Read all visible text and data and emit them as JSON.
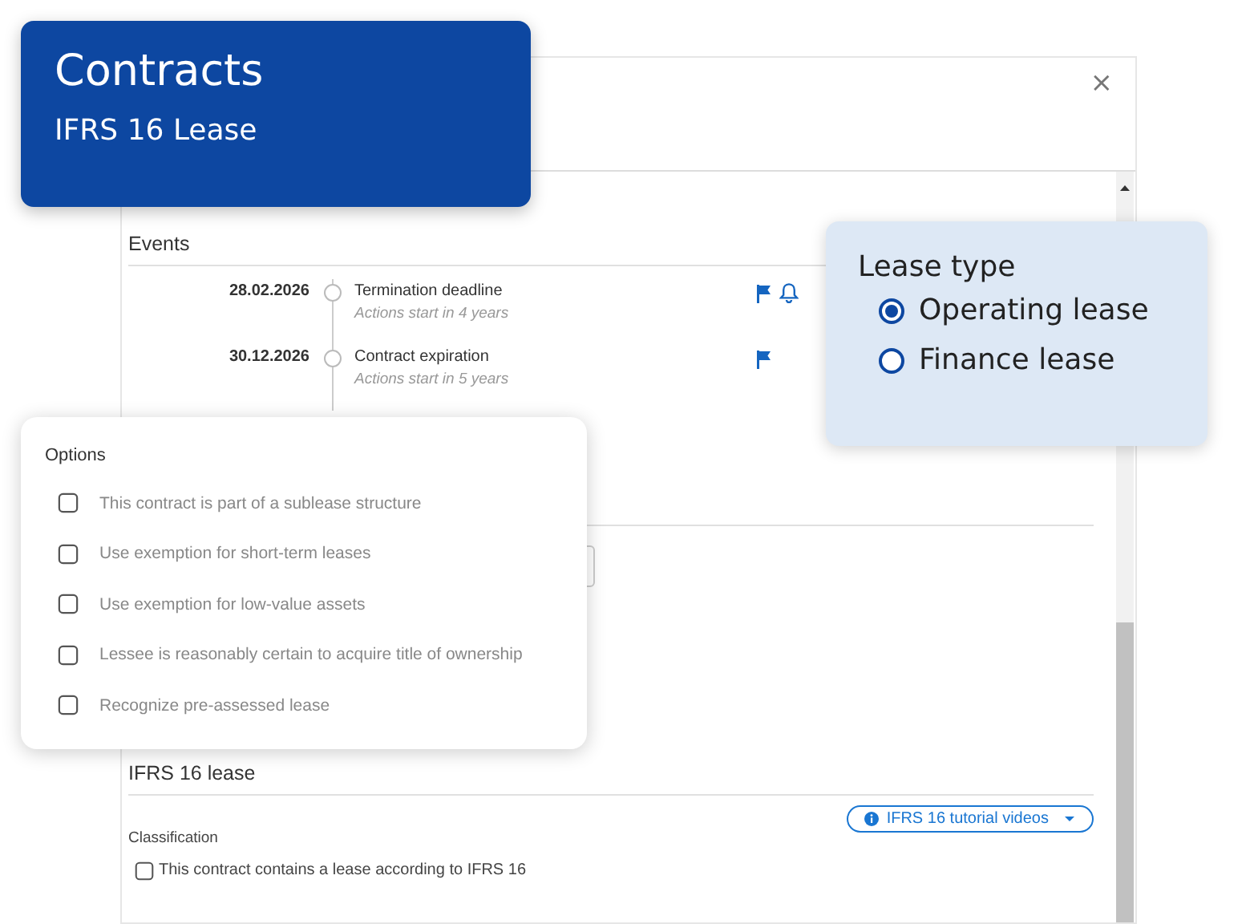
{
  "title_card": {
    "title": "Contracts",
    "subtitle": "IFRS 16 Lease"
  },
  "dialog": {
    "close": "×",
    "events": {
      "heading": "Events",
      "items": [
        {
          "date": "28.02.2026",
          "title": "Termination deadline",
          "note": "Actions start in 4 years",
          "flagged": true,
          "reminder": true
        },
        {
          "date": "30.12.2026",
          "title": "Contract expiration",
          "note": "Actions start in 5 years",
          "flagged": true,
          "reminder": false
        }
      ]
    },
    "ifrs": {
      "heading": "IFRS 16 lease",
      "tutorial_button": "IFRS 16 tutorial videos",
      "classification_label": "Classification",
      "checkbox": {
        "label": "This contract contains a lease according to IFRS 16",
        "checked": false
      }
    }
  },
  "lease_type": {
    "heading": "Lease type",
    "options": [
      {
        "label": "Operating lease",
        "selected": true
      },
      {
        "label": "Finance lease",
        "selected": false
      }
    ]
  },
  "options": {
    "heading": "Options",
    "items": [
      {
        "label": "This contract is part of a sublease structure",
        "checked": false
      },
      {
        "label": "Use exemption for short-term leases",
        "checked": false
      },
      {
        "label": "Use exemption for low-value assets",
        "checked": false
      },
      {
        "label": "Lessee is reasonably certain to acquire title of ownership",
        "checked": false
      },
      {
        "label": "Recognize pre-assessed lease",
        "checked": false
      }
    ]
  }
}
